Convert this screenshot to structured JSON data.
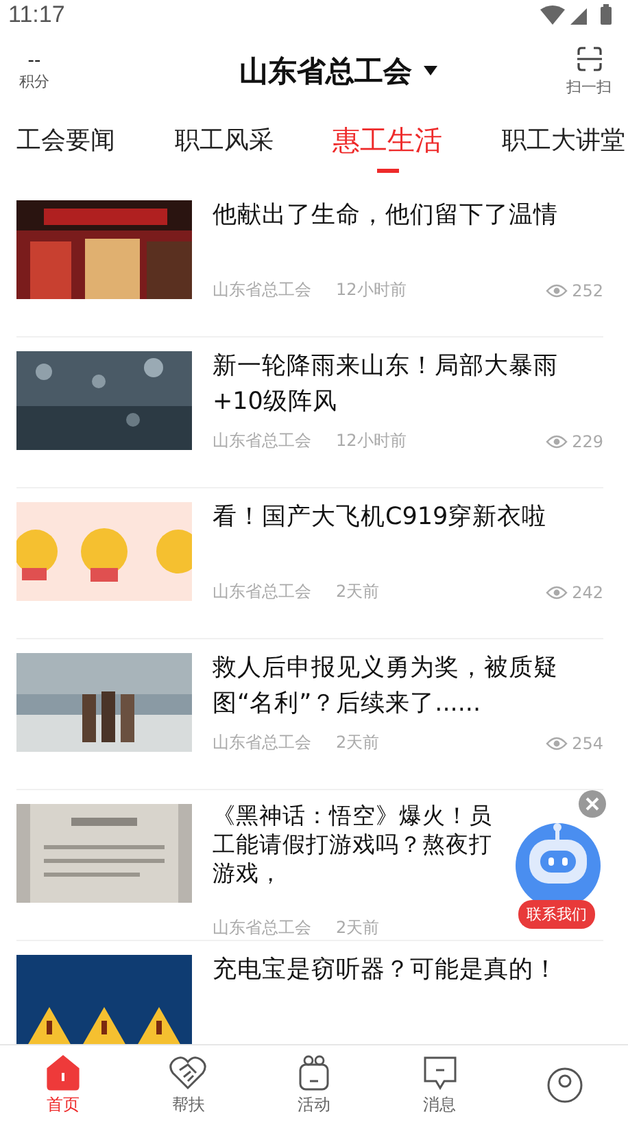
{
  "status_bar": {
    "time": "11:17"
  },
  "header": {
    "points_value": "--",
    "points_label": "积分",
    "title": "山东省总工会",
    "scan_label": "扫一扫"
  },
  "tabs": [
    {
      "label": "工会要闻",
      "selected": false
    },
    {
      "label": "职工风采",
      "selected": false
    },
    {
      "label": "惠工生活",
      "selected": true
    },
    {
      "label": "职工大讲堂",
      "selected": false
    }
  ],
  "articles": [
    {
      "title": "他献出了生命，他们留下了温情",
      "source": "山东省总工会",
      "time": "12小时前",
      "views": "252"
    },
    {
      "title": "新一轮降雨来山东！局部大暴雨+10级阵风",
      "source": "山东省总工会",
      "time": "12小时前",
      "views": "229"
    },
    {
      "title": "看！国产大飞机C919穿新衣啦",
      "source": "山东省总工会",
      "time": "2天前",
      "views": "242"
    },
    {
      "title": "救人后申报见义勇为奖，被质疑图“名利”？后续来了......",
      "source": "山东省总工会",
      "time": "2天前",
      "views": "254"
    },
    {
      "title": "《黑神话：悟空》爆火！员工能请假打游戏吗？熬夜打游戏，",
      "source": "山东省总工会",
      "time": "2天前"
    },
    {
      "title": "充电宝是窃听器？可能是真的！"
    }
  ],
  "floating_contact": {
    "label": "联系我们"
  },
  "bottom_nav": [
    {
      "label": "首页",
      "selected": true
    },
    {
      "label": "帮扶",
      "selected": false
    },
    {
      "label": "活动",
      "selected": false
    },
    {
      "label": "消息",
      "selected": false
    },
    {
      "selected": false
    }
  ]
}
